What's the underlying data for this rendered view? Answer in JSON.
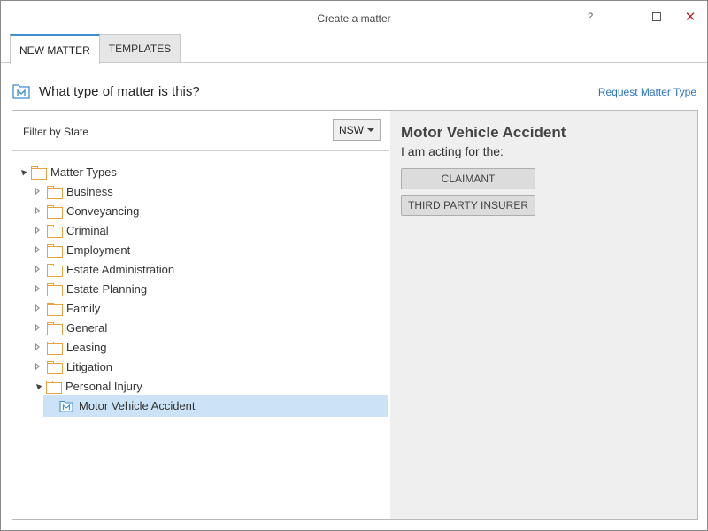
{
  "window": {
    "title": "Create a matter",
    "help_label": "?",
    "close_label": "✕"
  },
  "tabs": [
    {
      "label": "NEW MATTER",
      "active": true
    },
    {
      "label": "TEMPLATES",
      "active": false
    }
  ],
  "header": {
    "question": "What type of matter is this?",
    "request_link": "Request Matter Type"
  },
  "filter": {
    "label": "Filter by State",
    "state_value": "NSW"
  },
  "tree": {
    "root_label": "Matter Types",
    "items": [
      {
        "label": "Business",
        "expanded": false
      },
      {
        "label": "Conveyancing",
        "expanded": false
      },
      {
        "label": "Criminal",
        "expanded": false
      },
      {
        "label": "Employment",
        "expanded": false
      },
      {
        "label": "Estate Administration",
        "expanded": false
      },
      {
        "label": "Estate Planning",
        "expanded": false
      },
      {
        "label": "Family",
        "expanded": false
      },
      {
        "label": "General",
        "expanded": false
      },
      {
        "label": "Leasing",
        "expanded": false
      },
      {
        "label": "Litigation",
        "expanded": false
      },
      {
        "label": "Personal Injury",
        "expanded": true
      }
    ],
    "selected_child": "Motor Vehicle Accident"
  },
  "detail": {
    "title": "Motor Vehicle Accident",
    "acting_label": "I am acting for the:",
    "roles": [
      "CLAIMANT",
      "THIRD PARTY INSURER"
    ]
  },
  "colors": {
    "accent": "#3d8fd6",
    "link": "#2a74c4",
    "folder": "#e8a23a",
    "selection": "#cce3f7",
    "close": "#c0282e"
  }
}
